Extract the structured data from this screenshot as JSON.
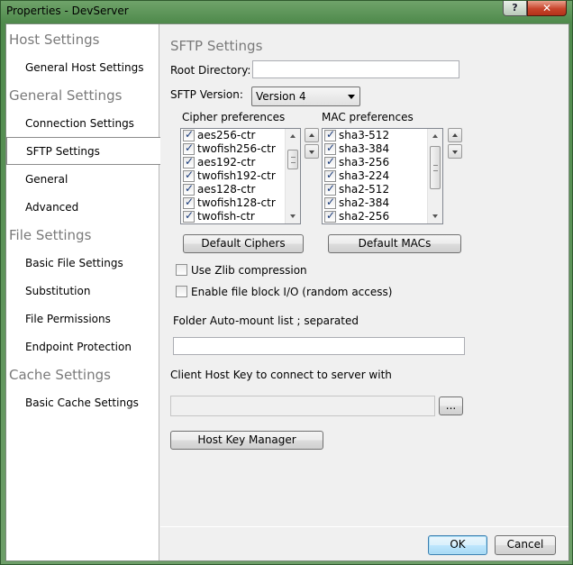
{
  "window": {
    "title": "Properties - DevServer",
    "help_label": "?",
    "close_label": "✕"
  },
  "sidebar": {
    "categories": [
      {
        "label": "Host Settings",
        "items": [
          "General Host Settings"
        ]
      },
      {
        "label": "General Settings",
        "items": [
          "Connection Settings",
          "SFTP Settings",
          "General",
          "Advanced"
        ]
      },
      {
        "label": "File Settings",
        "items": [
          "Basic File Settings",
          "Substitution",
          "File Permissions",
          "Endpoint Protection"
        ]
      },
      {
        "label": "Cache Settings",
        "items": [
          "Basic Cache Settings"
        ]
      }
    ],
    "selected": "SFTP Settings"
  },
  "main": {
    "heading": "SFTP Settings",
    "root_directory_label": "Root Directory:",
    "root_directory_value": "",
    "sftp_version_label": "SFTP Version:",
    "sftp_version_value": "Version 4",
    "cipher_label": "Cipher preferences",
    "ciphers": [
      {
        "name": "aes256-ctr",
        "checked": true
      },
      {
        "name": "twofish256-ctr",
        "checked": true
      },
      {
        "name": "aes192-ctr",
        "checked": true
      },
      {
        "name": "twofish192-ctr",
        "checked": true
      },
      {
        "name": "aes128-ctr",
        "checked": true
      },
      {
        "name": "twofish128-ctr",
        "checked": true
      },
      {
        "name": "twofish-ctr",
        "checked": true
      }
    ],
    "mac_label": "MAC preferences",
    "macs": [
      {
        "name": "sha3-512",
        "checked": true
      },
      {
        "name": "sha3-384",
        "checked": true
      },
      {
        "name": "sha3-256",
        "checked": true
      },
      {
        "name": "sha3-224",
        "checked": true
      },
      {
        "name": "sha2-512",
        "checked": true
      },
      {
        "name": "sha2-384",
        "checked": true
      },
      {
        "name": "sha2-256",
        "checked": true
      }
    ],
    "default_ciphers_label": "Default Ciphers",
    "default_macs_label": "Default MACs",
    "zlib_label": "Use Zlib compression",
    "zlib_checked": false,
    "block_io_label": "Enable file block I/O (random access)",
    "block_io_checked": false,
    "automount_label": "Folder Auto-mount list ; separated",
    "automount_value": "",
    "client_host_key_label": "Client Host Key to connect to server with",
    "client_host_key_value": "",
    "browse_label": "...",
    "host_key_manager_label": "Host Key Manager",
    "ok_label": "OK",
    "cancel_label": "Cancel"
  }
}
